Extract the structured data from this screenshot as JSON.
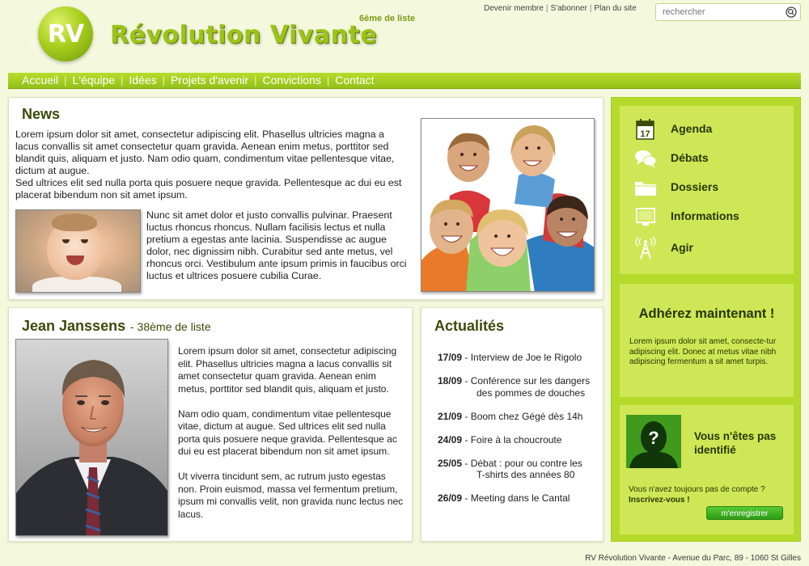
{
  "header": {
    "logo_text": "RV",
    "site_title": "Révolution Vivante",
    "subtitle": "6ème de liste",
    "top_links": [
      "Devenir membre",
      "S'abonner",
      "Plan du site"
    ],
    "search_placeholder": "rechercher"
  },
  "nav": [
    "Accueil",
    "L'équipe",
    "Idées",
    "Projets d'avenir",
    "Convictions",
    "Contact"
  ],
  "news": {
    "title": "News",
    "para1": "Lorem ipsum dolor sit amet, consectetur adipiscing elit. Phasellus ultricies magna a lacus convallis sit amet consectetur quam gravida. Aenean enim metus, porttitor sed blandit quis, aliquam et justo. Nam odio quam, condimentum vitae pellentesque vitae, dictum at augue.",
    "para2": "Sed ultrices elit sed nulla porta quis posuere neque gravida. Pellentesque ac dui eu est placerat bibendum non sit amet ipsum.",
    "para3": "Nunc sit amet dolor et justo convallis pulvinar. Praesent luctus rhoncus rhoncus. Nullam facilisis lectus et nulla pretium a egestas ante lacinia. Suspendisse ac augue dolor, nec dignissim nibh. Curabitur sed ante metus, vel rhoncus orci. Vestibulum ante ipsum primis in faucibus orci luctus et ultrices posuere cubilia Curae."
  },
  "person": {
    "name": "Jean Janssens",
    "rank": "- 38ème de liste",
    "para1": "Lorem ipsum dolor sit amet, consectetur adipiscing elit. Phasellus ultricies magna a lacus convallis sit amet consectetur quam gravida. Aenean enim metus, porttitor sed blandit quis, aliquam et justo.",
    "para2": "Nam odio quam, condimentum vitae pellentesque vitae, dictum at augue. Sed ultrices elit sed nulla porta quis posuere neque gravida. Pellentesque ac dui eu est placerat bibendum non sit amet ipsum.",
    "para3": "Ut viverra tincidunt sem, ac rutrum justo egestas non. Proin euismod, massa vel fermentum pretium, ipsum mi convallis velit, non gravida nunc lectus nec lacus."
  },
  "actus": {
    "title": "Actualités",
    "items": [
      {
        "date": "17/09",
        "text": "- Interview de Joe le Rigolo",
        "cont": ""
      },
      {
        "date": "18/09",
        "text": "- Conférence sur les dangers",
        "cont": "des pommes de douches"
      },
      {
        "date": "21/09",
        "text": "- Boom chez Gégé dès 14h",
        "cont": ""
      },
      {
        "date": "24/09",
        "text": "- Foire à la choucroute",
        "cont": ""
      },
      {
        "date": "25/05",
        "text": "- Débat : pour ou contre les",
        "cont": "T-shirts des années 80"
      },
      {
        "date": "26/09",
        "text": "- Meeting dans le Cantal",
        "cont": ""
      }
    ]
  },
  "sidebar": {
    "calendar_day": "17",
    "menu": [
      {
        "label": "Agenda",
        "icon": "calendar-icon"
      },
      {
        "label": "Débats",
        "icon": "speech-bubbles-icon"
      },
      {
        "label": "Dossiers",
        "icon": "folder-icon"
      },
      {
        "label": "Informations",
        "icon": "monitor-icon"
      },
      {
        "label": "Agir",
        "icon": "antenna-icon"
      }
    ],
    "join_title": "Adhérez maintenant !",
    "join_text": "Lorem ipsum dolor sit amet, consecte-tur adipiscing elit. Donec at metus vitae nibh adipiscing fermentum a sit amet turpis.",
    "login_title_line1": "Vous n'êtes pas",
    "login_title_line2": "identifié",
    "login_text": "Vous n'avez toujours pas de compte ?",
    "login_cta": "Inscrivez-vous !",
    "register_label": "m'enregistrer",
    "avatar_mark": "?"
  },
  "footer": "RV Révolution Vivante - Avenue du Parc, 89 - 1060 St Gilles",
  "colors": {
    "accent": "#9cc417",
    "sidebar": "#b6da2c",
    "panel": "#cfe756",
    "title": "#3a4a08",
    "background": "#f4f8dc"
  }
}
